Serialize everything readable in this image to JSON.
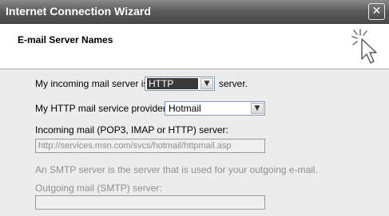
{
  "window": {
    "title": "Internet Connection Wizard",
    "close_glyph": "✕"
  },
  "header": {
    "title": "E-mail Server Names",
    "icon": "wizard-sparkle-cursor-icon"
  },
  "form": {
    "incoming_type_prefix": "My incoming mail server is a",
    "incoming_type_value": "HTTP",
    "incoming_type_suffix": "server.",
    "provider_label": "My HTTP mail service provider is",
    "provider_value": "Hotmail",
    "incoming_server_label": "Incoming mail (POP3, IMAP or HTTP) server:",
    "incoming_server_value": "http://services.msn.com/svcs/hotmail/httpmail.asp",
    "smtp_info": "An SMTP server is the server that is used for your outgoing e-mail.",
    "outgoing_server_label": "Outgoing mail (SMTP) server:",
    "outgoing_server_value": ""
  },
  "colors": {
    "dialog_bg": "#ececec",
    "header_bg": "#ffffff",
    "titlebar": "#5a5a5a",
    "disabled_text": "#8e8e8e"
  }
}
